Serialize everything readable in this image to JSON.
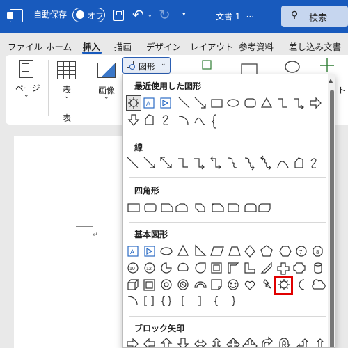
{
  "titlebar": {
    "autosave_label": "自動保存",
    "toggle_label": "オフ",
    "doc_title": "文書 1  -···",
    "search_label": "検索"
  },
  "menu": {
    "tabs": [
      "ファイル",
      "ホーム",
      "挿入",
      "描画",
      "デザイン",
      "レイアウト",
      "参考資料",
      "差し込み文書"
    ],
    "active": "挿入"
  },
  "ribbon": {
    "page_label": "ページ",
    "table_label": "表",
    "table_group_label": "表",
    "image_label": "画像",
    "shapes_label": "図形",
    "cut_label": "ト"
  },
  "dropdown": {
    "recent_title": "最近使用した図形",
    "lines_title": "線",
    "rect_title": "四角形",
    "basic_title": "基本図形",
    "block_title": "ブロック矢印",
    "num_labels": [
      "7",
      "8",
      "10",
      "12"
    ],
    "highlighted_shape": "sun-shape"
  },
  "colors": {
    "titlebar": "#185abd",
    "highlight": "#e00000",
    "accent": "#2b5eb2"
  }
}
